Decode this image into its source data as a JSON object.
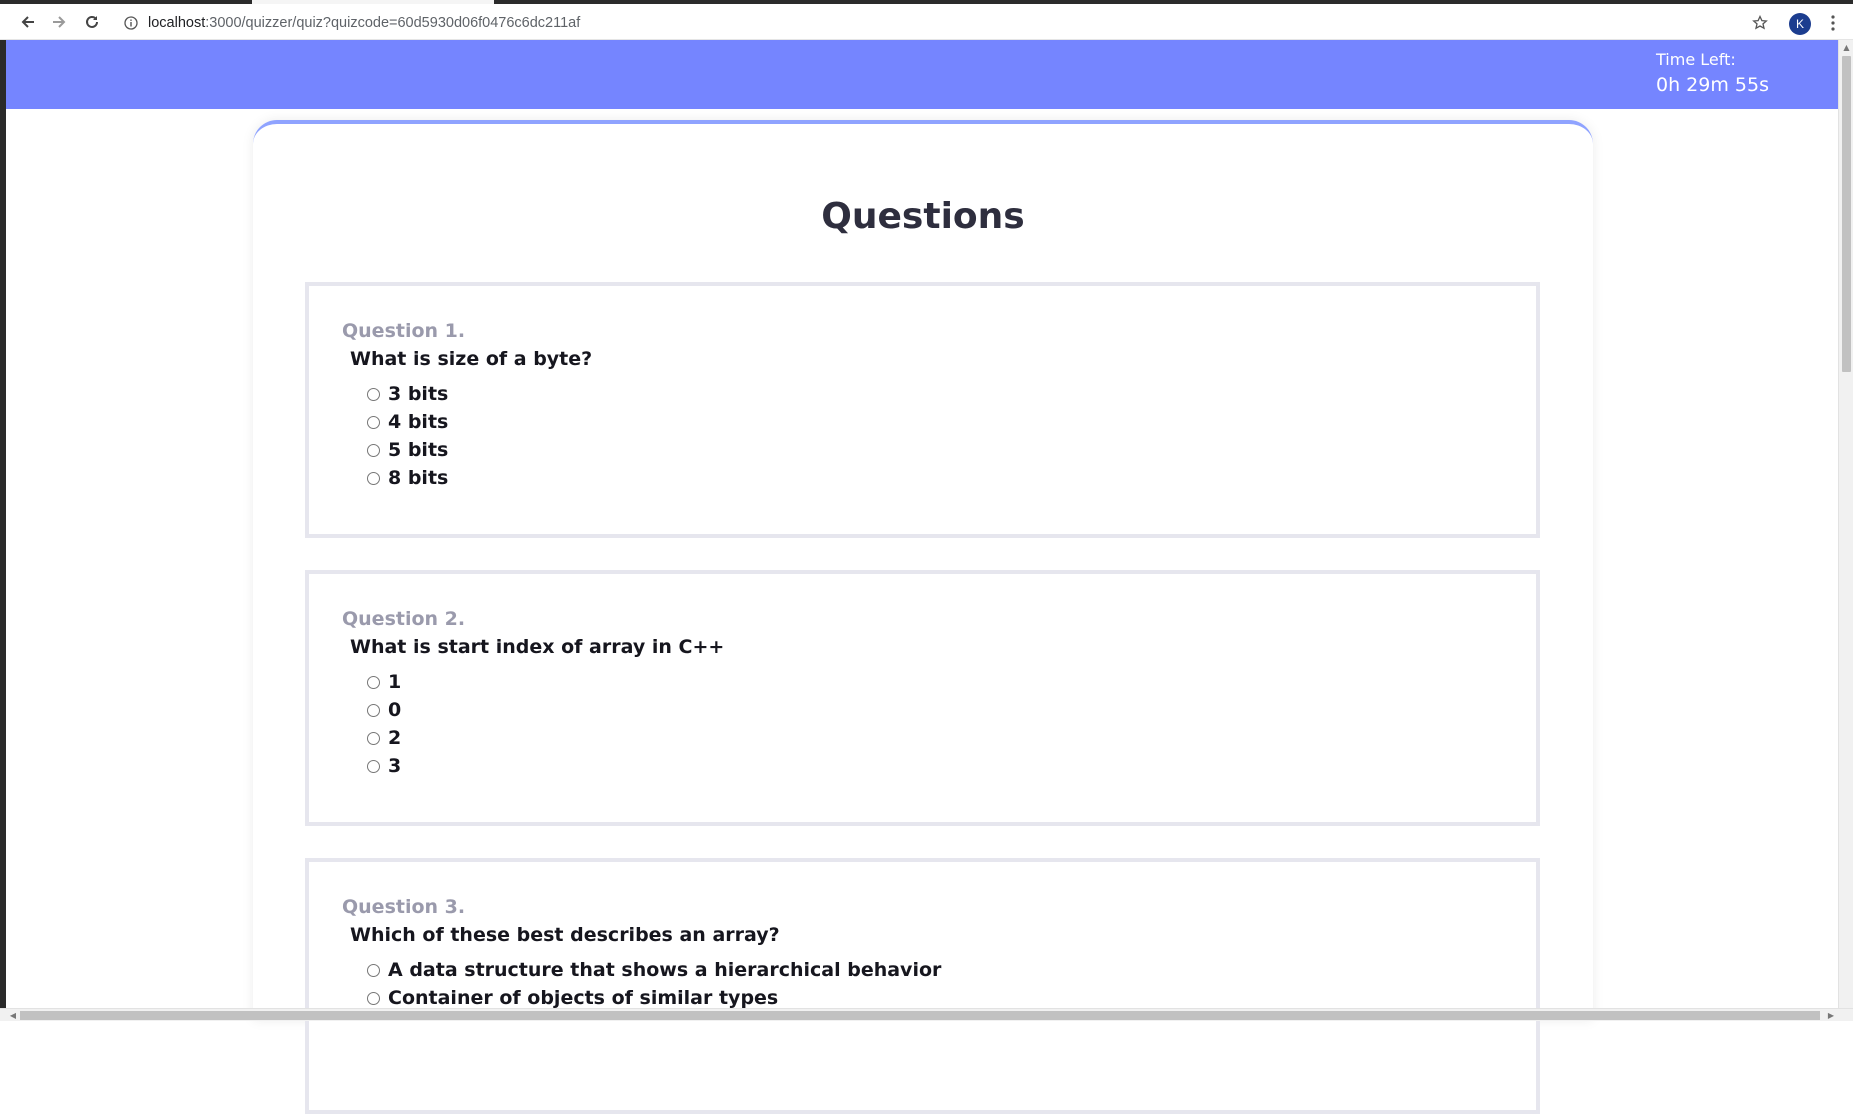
{
  "browser": {
    "url_host": "localhost",
    "url_rest": ":3000/quizzer/quiz?quizcode=60d5930d06f0476c6dc211af",
    "avatar_letter": "K",
    "icons": [
      "back-arrow-icon",
      "forward-arrow-icon",
      "reload-icon",
      "info-icon",
      "star-icon",
      "kebab-menu-icon"
    ]
  },
  "header": {
    "timer_label": "Time Left:",
    "timer_value": "0h 29m 55s",
    "color": "#7585ff"
  },
  "main": {
    "title": "Questions",
    "questions": [
      {
        "number": "Question 1.",
        "text": "What is size of a byte?",
        "options": [
          "3 bits",
          "4 bits",
          "5 bits",
          "8 bits"
        ]
      },
      {
        "number": "Question 2.",
        "text": "What is start index of array in C++",
        "options": [
          "1",
          "0",
          "2",
          "3"
        ]
      },
      {
        "number": "Question 3.",
        "text": "Which of these best describes an array?",
        "options": [
          "A data structure that shows a hierarchical behavior",
          "Container of objects of similar types"
        ]
      }
    ]
  }
}
